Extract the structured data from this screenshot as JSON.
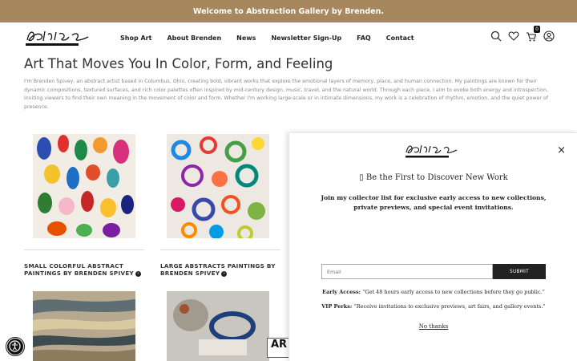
{
  "announcement": "Welcome to Abstraction Gallery by Brenden.",
  "logo_alt": "Abstraction Gallery by Brenden",
  "nav": [
    "Shop Art",
    "About Brenden",
    "News",
    "Newsletter Sign-Up",
    "FAQ",
    "Contact"
  ],
  "cart_count": "0",
  "page_title": "Art That Moves You In Color, Form, and Feeling",
  "intro": "I'm Brenden Spivey, an abstract artist based in Columbus, Ohio, creating bold, vibrant works that explore the emotional layers of memory, place, and human connection. My paintings are known for their dynamic compositions, textured surfaces, and rich color palettes often inspired by mid-century design, music, travel, and the natural world. Through each piece, I aim to evoke both energy and introspection, inviting viewers to find their own meaning in the movement of color and form. Whether I'm working large-scale or in intimate dimensions, my work is a celebration of rhythm, emotion, and the quiet power of presence.",
  "collections": [
    {
      "title_line1": "SMALL COLORFUL ABSTRACT",
      "title_line2": "PAINTINGS BY BRENDEN SPIVEY"
    },
    {
      "title_line1": "LARGE ABSTRACTS PAINTINGS BY",
      "title_line2": "BRENDEN SPIVEY"
    }
  ],
  "popup": {
    "close": "×",
    "heading": "▯ Be the First to Discover New Work",
    "subheading": "Join my collector list for exclusive early access to new collections, private previews, and special event invitations.",
    "email_placeholder": "Email",
    "submit": "SUBMIT",
    "perk1_label": "Early Access:",
    "perk1_text": " “Get 48 hours early access to new collections before they go public.”",
    "perk2_label": "VIP Perks:",
    "perk2_text": " “Receive invitations to exclusive previews, art fairs, and gallery events.”",
    "no_thanks": "No thanks"
  },
  "badge_text": "AR",
  "colors": {
    "announce_bg": "#a6875e",
    "button_dark": "#222222"
  }
}
